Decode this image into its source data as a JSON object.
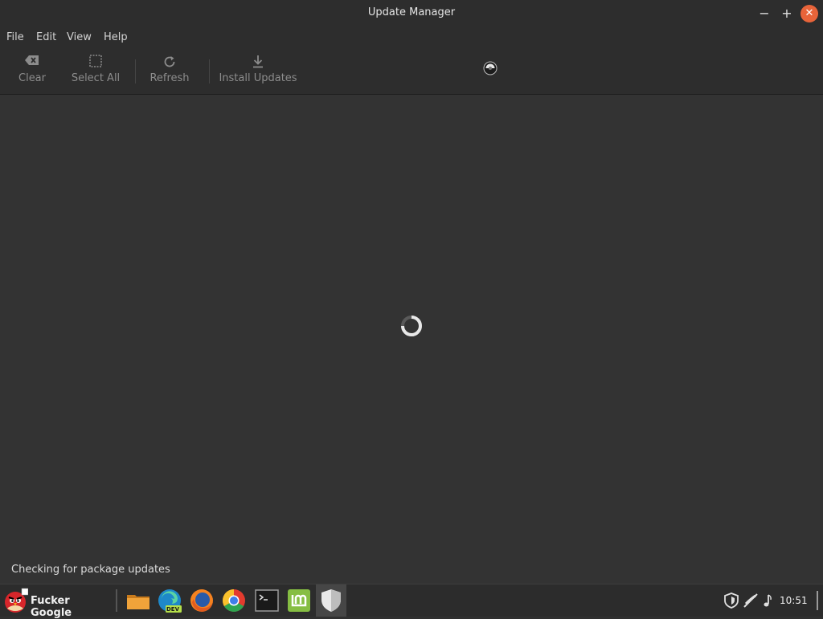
{
  "window": {
    "title": "Update Manager",
    "minimize_glyph": "−",
    "maximize_glyph": "+",
    "close_glyph": "✕"
  },
  "menubar": {
    "items": [
      "File",
      "Edit",
      "View",
      "Help"
    ]
  },
  "toolbar": {
    "clear_label": "Clear",
    "select_all_label": "Select All",
    "refresh_label": "Refresh",
    "install_label": "Install Updates"
  },
  "status": {
    "text": "Checking for package updates"
  },
  "taskbar": {
    "menu_label": "Fucker Google",
    "edge_badge": "DEV",
    "clock": "10:51"
  },
  "colors": {
    "close_button": "#e8643a",
    "mint_green": "#86be43",
    "accent": "#e6e6e6"
  }
}
